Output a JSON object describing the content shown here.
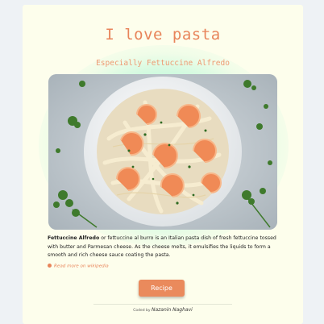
{
  "header": {
    "title": "I love pasta",
    "subtitle": "Especially Fettuccine Alfredo"
  },
  "photo": {
    "alt": "Fettuccine Alfredo with shrimp and parsley in a white bowl"
  },
  "description": {
    "dish_name": "Fettuccine Alfredo",
    "text": " or fettuccine al burro is an Italian pasta dish of fresh fettuccine tossed with butter and Parmesan cheese. As the cheese melts, it emulsifies the liquids to form a smooth and rich cheese sauce coating the pasta."
  },
  "links": {
    "wikipedia": "Read more on wikipedia"
  },
  "actions": {
    "recipe_label": "Recipe"
  },
  "footer": {
    "coded_by": "Coded by",
    "author": "Nazanin Naghavi"
  },
  "colors": {
    "accent": "#e8845a",
    "card_bg": "#fdfeec",
    "glow": "#78f0c8"
  }
}
